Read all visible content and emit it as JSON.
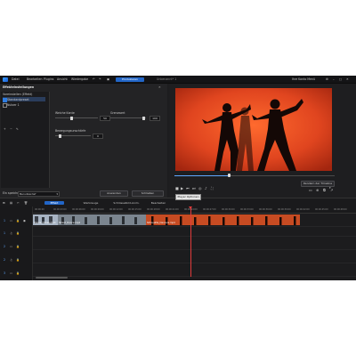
{
  "app": {
    "menu": [
      "Datei",
      "Bearbeiten",
      "Plugins",
      "Ansicht",
      "Wiedergabe"
    ],
    "produce_button": "Produzieren",
    "project_title": "Unbenannt* 1",
    "account": "Ihre Konto Menü"
  },
  "panel": {
    "title": "Effekteinstellungen",
    "presets_heading": "Voreinstellen (Effekt)",
    "presets": [
      {
        "label": "Standardpreset",
        "checked": true
      },
      {
        "label": "Nutzer 1",
        "checked": false
      }
    ],
    "params": [
      {
        "label": "Weiche Kante",
        "value": "50"
      },
      {
        "label": "Grenzwert",
        "value": "100"
      },
      {
        "label": "Bewegungsunschärfe",
        "value": "0"
      }
    ],
    "save_as_label": "Ein speichern",
    "save_as_value": "Benutzerdef",
    "apply_button": "Anwenden",
    "close_button": "Schließen"
  },
  "preview": {
    "render_button": "Rendern der Timeline",
    "tooltip": "Player Optionen",
    "timecode": "00:00:18:22"
  },
  "toolbar": {
    "fx_button": "Effekt",
    "items": [
      "Werkzeuge",
      "Schlüsselbild-Anim.",
      "Bearbeiten"
    ]
  },
  "ruler_ticks": [
    "00:00:00",
    "00:00:03:00",
    "00:00:06:00",
    "00:00:09:00",
    "00:00:12:00",
    "00:00:15:00",
    "00:00:18:00",
    "00:00:21:00",
    "00:00:24:00",
    "00:00:27:00",
    "00:00:30:00",
    "00:00:33:00",
    "00:00:36:00",
    "00:00:39:00",
    "00:00:42:00",
    "00:00:45:00",
    "00:00:48:00"
  ],
  "tracks": [
    "1",
    "1",
    "2",
    "2",
    "3"
  ],
  "clips": [
    {
      "caption": "Dance_Moves.mp4"
    },
    {
      "caption": "Street_Dance.mp4"
    },
    {
      "caption": "Silhouette_Dancers.mp4"
    }
  ],
  "colors": {
    "accent": "#2266c8",
    "clip_orange": "#c74b22",
    "playhead": "#e23b3b"
  }
}
